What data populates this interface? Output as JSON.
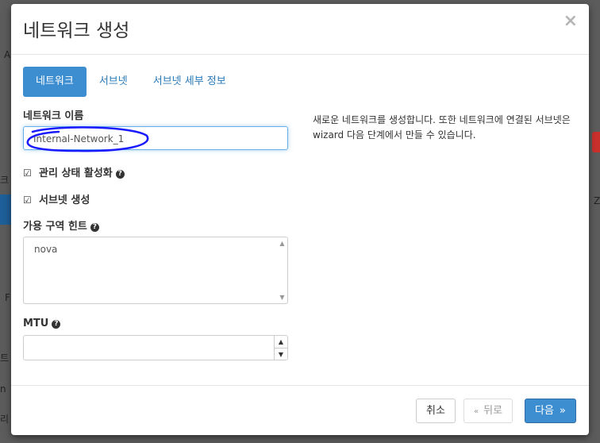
{
  "dialog": {
    "title": "네트워크 생성",
    "close_icon": "×"
  },
  "tabs": [
    {
      "label": "네트워크",
      "active": true
    },
    {
      "label": "서브넷",
      "active": false
    },
    {
      "label": "서브넷 세부 정보",
      "active": false
    }
  ],
  "form": {
    "network_name_label": "네트워크 이름",
    "network_name_value": "Internal-Network_1",
    "admin_state_label": "관리 상태 활성화",
    "admin_state_checked": true,
    "create_subnet_label": "서브넷 생성",
    "create_subnet_checked": true,
    "az_hint_label": "가용 구역 힌트",
    "az_hint_options": [
      "nova"
    ],
    "mtu_label": "MTU",
    "mtu_value": ""
  },
  "description": "새로운 네트워크를 생성합니다. 또한 네트워크에 연결된 서브넷은 wizard 다음 단계에서 만들 수 있습니다.",
  "footer": {
    "cancel_label": "취소",
    "back_label": "뒤로",
    "back_prefix": "«",
    "next_label": "다음",
    "next_suffix": "»"
  },
  "background_fragments": [
    "A",
    "크",
    "F",
    "트",
    "n",
    "리 X",
    "Z"
  ],
  "colors": {
    "primary": "#3d8ed1",
    "link": "#2a7ab8",
    "overlay": "#5c5c5c",
    "ink": "#1a1aff"
  }
}
